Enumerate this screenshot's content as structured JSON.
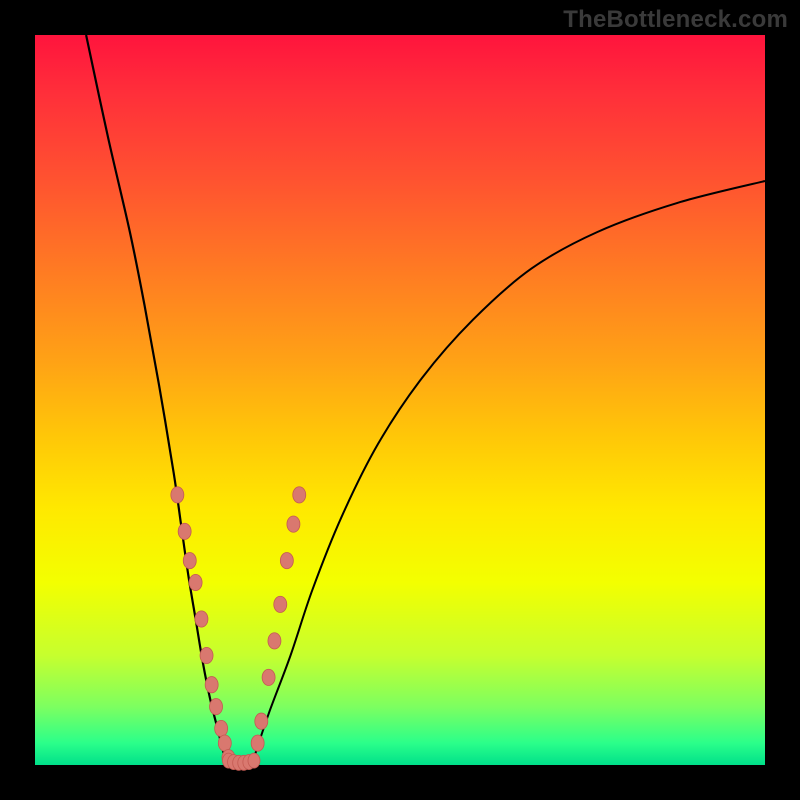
{
  "watermark": "TheBottleneck.com",
  "chart_data": {
    "type": "line",
    "title": "",
    "xlabel": "",
    "ylabel": "",
    "xlim": [
      0,
      100
    ],
    "ylim": [
      0,
      100
    ],
    "grid": false,
    "legend": false,
    "background_gradient": {
      "direction": "vertical",
      "stops": [
        {
          "pos": 0,
          "color": "#ff143d"
        },
        {
          "pos": 50,
          "color": "#ffc700"
        },
        {
          "pos": 100,
          "color": "#00e08a"
        }
      ]
    },
    "series": [
      {
        "name": "left-branch",
        "style": "solid-black",
        "x": [
          7,
          10,
          13,
          15,
          17,
          19,
          20,
          21,
          22,
          23,
          24,
          25,
          26
        ],
        "y": [
          100,
          86,
          73,
          63,
          52,
          40,
          33,
          26,
          20,
          14,
          9,
          5,
          1
        ]
      },
      {
        "name": "right-branch",
        "style": "solid-black",
        "x": [
          30,
          32,
          35,
          38,
          42,
          47,
          53,
          60,
          68,
          77,
          88,
          100
        ],
        "y": [
          1,
          7,
          15,
          24,
          34,
          44,
          53,
          61,
          68,
          73,
          77,
          80
        ]
      },
      {
        "name": "left-markers",
        "style": "pink-dots",
        "x": [
          19.5,
          20.5,
          21.2,
          22.0,
          22.8,
          23.5,
          24.2,
          24.8,
          25.5,
          26.0,
          26.5
        ],
        "y": [
          37,
          32,
          28,
          25,
          20,
          15,
          11,
          8,
          5,
          3,
          1
        ]
      },
      {
        "name": "right-markers",
        "style": "pink-dots",
        "x": [
          30.5,
          31.0,
          32.0,
          32.8,
          33.6,
          34.5,
          35.4,
          36.2
        ],
        "y": [
          3,
          6,
          12,
          17,
          22,
          28,
          33,
          37
        ]
      },
      {
        "name": "valley-floor",
        "style": "pink-dots",
        "x": [
          26.5,
          27.2,
          27.9,
          28.6,
          29.3,
          30.0
        ],
        "y": [
          0.6,
          0.4,
          0.3,
          0.3,
          0.4,
          0.6
        ]
      }
    ],
    "interpretation_note": "V-shaped bottleneck curve; y approaches 0 near x≈28 (optimal match), rises steeply on left branch to 100 at x≈7 and gradually on right branch to ≈80 at x=100. Pink markers highlight sampled points on both flanks and valley."
  },
  "colors": {
    "curve": "#000000",
    "marker_fill": "#d9786f",
    "marker_stroke": "#c45a52"
  }
}
